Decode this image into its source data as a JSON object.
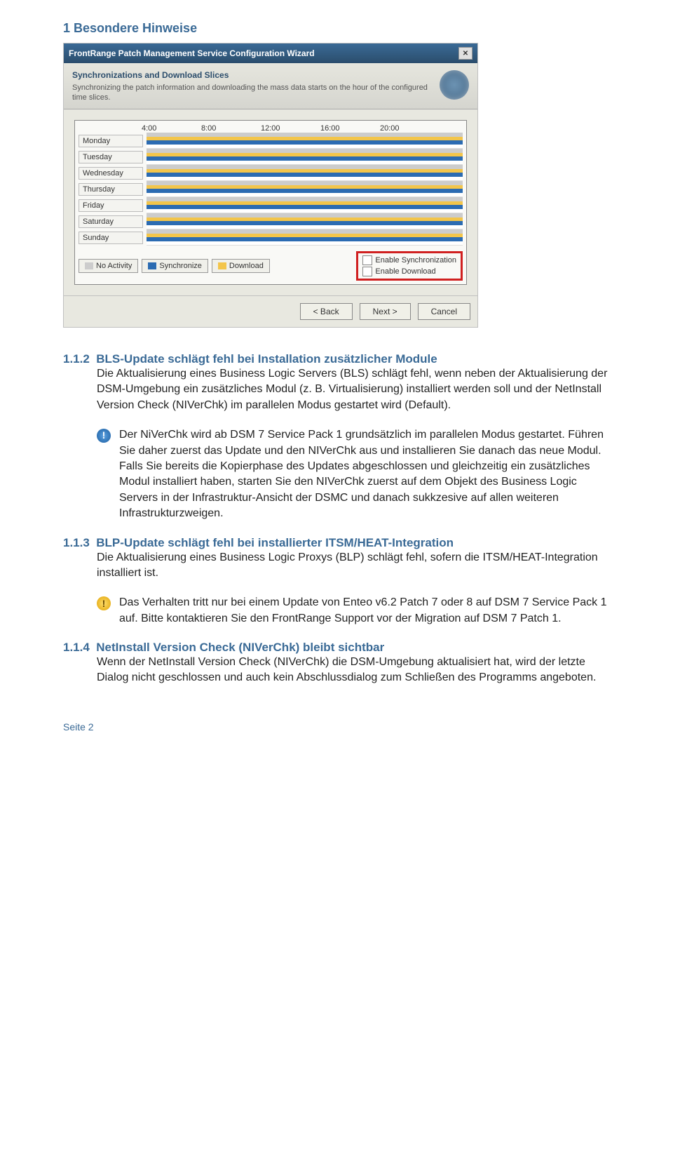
{
  "chapter": "1 Besondere Hinweise",
  "screenshot": {
    "title": "FrontRange Patch Management Service Configuration Wizard",
    "panel_title": "Synchronizations and Download Slices",
    "panel_desc": "Synchronizing the patch information and downloading the mass data starts on the hour of the configured time slices.",
    "time_headers": [
      "4:00",
      "8:00",
      "12:00",
      "16:00",
      "20:00"
    ],
    "days": [
      "Monday",
      "Tuesday",
      "Wednesday",
      "Thursday",
      "Friday",
      "Saturday",
      "Sunday"
    ],
    "legend_no_activity": "No Activity",
    "legend_synchronize": "Synchronize",
    "legend_download": "Download",
    "enable_sync": "Enable Synchronization",
    "enable_download": "Enable Download",
    "btn_back": "< Back",
    "btn_next": "Next >",
    "btn_cancel": "Cancel"
  },
  "s112": {
    "num": "1.1.2",
    "title": "BLS-Update schlägt fehl bei Installation zusätzlicher Module",
    "body": "Die Aktualisierung eines Business Logic Servers (BLS) schlägt fehl, wenn neben der Aktualisierung der DSM-Umgebung ein zusätzliches Modul (z. B. Virtualisierung) installiert werden soll und der NetInstall Version Check (NIVerChk) im parallelen Modus gestartet wird (Default).",
    "note": "Der NiVerChk wird ab DSM 7 Service Pack 1 grundsätzlich im parallelen Modus gestartet. Führen Sie daher zuerst das Update und den NIVerChk aus und installieren Sie danach das neue Modul. Falls Sie bereits die Kopierphase des Updates abgeschlossen und gleichzeitig ein zusätzliches Modul installiert haben, starten Sie den NIVerChk zuerst auf dem Objekt des Business Logic Servers in der Infrastruktur-Ansicht der DSMC und danach sukkzesive auf allen weiteren Infrastrukturzweigen."
  },
  "s113": {
    "num": "1.1.3",
    "title": "BLP-Update schlägt fehl bei installierter ITSM/HEAT-Integration",
    "body": "Die Aktualisierung eines Business Logic Proxys (BLP) schlägt fehl, sofern die ITSM/HEAT-Integration installiert ist.",
    "note": "Das Verhalten tritt nur bei einem Update von Enteo v6.2 Patch 7 oder 8 auf DSM 7 Service Pack 1 auf. Bitte kontaktieren Sie den FrontRange Support vor der Migration auf DSM 7 Patch 1."
  },
  "s114": {
    "num": "1.1.4",
    "title": "NetInstall Version Check (NIVerChk) bleibt sichtbar",
    "body": "Wenn der NetInstall Version Check (NIVerChk) die DSM-Umgebung aktualisiert hat, wird der letzte Dialog nicht geschlossen und auch kein Abschlussdialog zum Schließen des Programms angeboten."
  },
  "footer": "Seite 2"
}
